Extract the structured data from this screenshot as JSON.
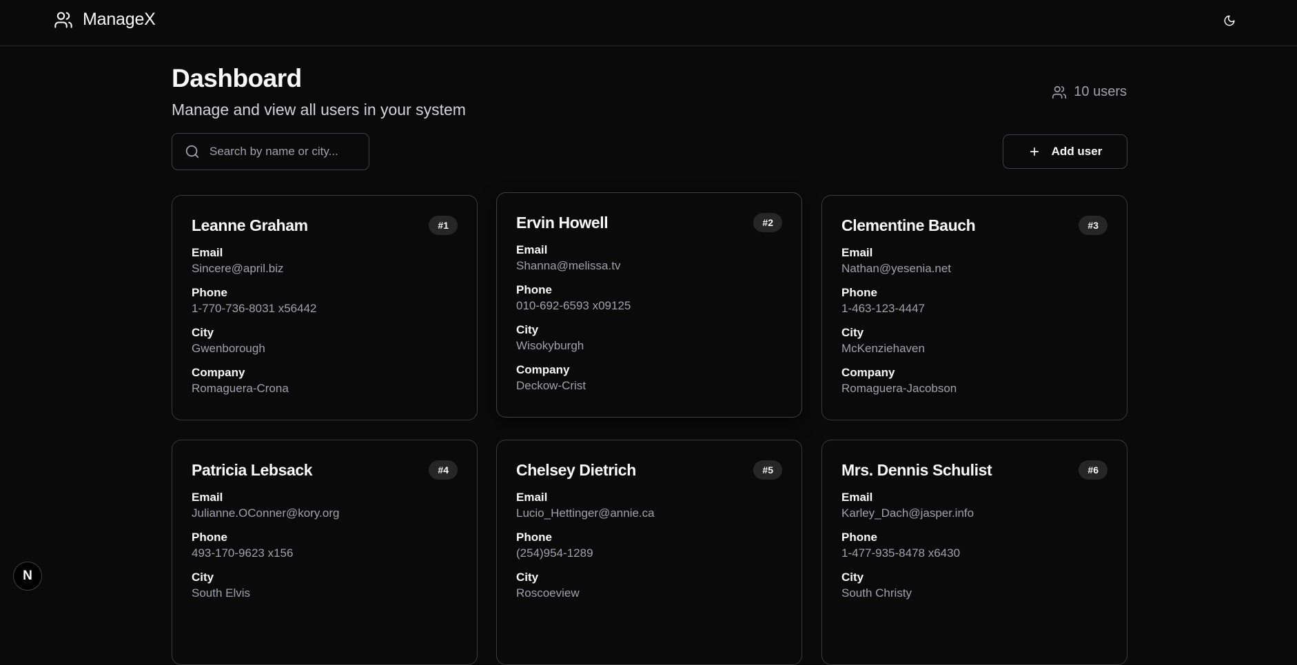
{
  "header": {
    "brand": "ManageX",
    "brand_icon": "users-icon",
    "theme_icon": "moon-icon"
  },
  "page": {
    "title": "Dashboard",
    "subtitle": "Manage and view all users in your system",
    "user_count": "10 users"
  },
  "search": {
    "placeholder": "Search by name or city...",
    "value": ""
  },
  "actions": {
    "add_user": "Add user"
  },
  "field_labels": {
    "email": "Email",
    "phone": "Phone",
    "city": "City",
    "company": "Company"
  },
  "users": [
    {
      "name": "Leanne Graham",
      "badge": "#1",
      "email": "Sincere@april.biz",
      "phone": "1-770-736-8031 x56442",
      "city": "Gwenborough",
      "company": "Romaguera-Crona"
    },
    {
      "name": "Ervin Howell",
      "badge": "#2",
      "email": "Shanna@melissa.tv",
      "phone": "010-692-6593 x09125",
      "city": "Wisokyburgh",
      "company": "Deckow-Crist"
    },
    {
      "name": "Clementine Bauch",
      "badge": "#3",
      "email": "Nathan@yesenia.net",
      "phone": "1-463-123-4447",
      "city": "McKenziehaven",
      "company": "Romaguera-Jacobson"
    },
    {
      "name": "Patricia Lebsack",
      "badge": "#4",
      "email": "Julianne.OConner@kory.org",
      "phone": "493-170-9623 x156",
      "city": "South Elvis",
      "company": ""
    },
    {
      "name": "Chelsey Dietrich",
      "badge": "#5",
      "email": "Lucio_Hettinger@annie.ca",
      "phone": "(254)954-1289",
      "city": "Roscoeview",
      "company": ""
    },
    {
      "name": "Mrs. Dennis Schulist",
      "badge": "#6",
      "email": "Karley_Dach@jasper.info",
      "phone": "1-477-935-8478 x6430",
      "city": "South Christy",
      "company": ""
    }
  ],
  "footer": {
    "next_badge": "N"
  }
}
